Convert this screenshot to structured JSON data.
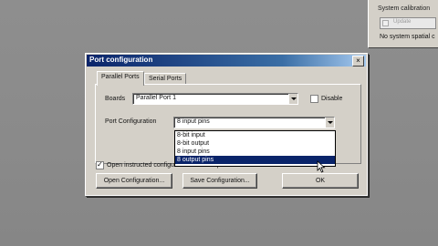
{
  "top_right": {
    "group_label": "System calibration",
    "field_text": "Update",
    "status": "No system spatial c"
  },
  "dialog": {
    "title": "Port configuration",
    "close_label": "×",
    "tabs": [
      "Parallel Ports",
      "Serial Ports"
    ],
    "boards_label": "Boards",
    "boards_value": "Parallel Port 1",
    "disable_label": "Disable",
    "port_config_label": "Port Configuration",
    "port_config_value": "8 input pins",
    "dropdown_options": [
      "8-bit input",
      "8-bit output",
      "8 input pins",
      "8 output pins"
    ],
    "dropdown_selected": "8 output pins",
    "open_on_startup_label": "Open instructed configuration on startup",
    "buttons": {
      "open": "Open Configuration...",
      "save": "Save Configuration...",
      "ok": "OK"
    }
  }
}
